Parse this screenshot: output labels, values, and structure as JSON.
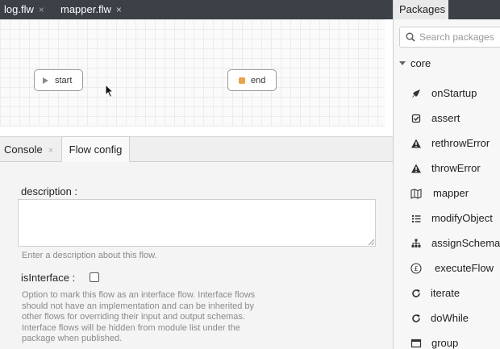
{
  "editor_tabs": [
    {
      "label": "log.flw",
      "close": "×"
    },
    {
      "label": "mapper.flw",
      "close": "×"
    }
  ],
  "flow_nodes": {
    "start": "start",
    "end": "end"
  },
  "bottom_tabs": {
    "console": {
      "label": "Console",
      "close": "×"
    },
    "flow_config": {
      "label": "Flow config"
    }
  },
  "config": {
    "description_label": "description :",
    "description_value": "",
    "description_help": "Enter a description about this flow.",
    "is_interface_label": "isInterface :",
    "is_interface_checked": false,
    "is_interface_help": "Option to mark this flow as an interface flow. Interface flows should not have an implementation and can be inherited by other flows for overriding their input and output schemas. Interface flows will be hidden from module list under the package when published."
  },
  "packages": {
    "title": "Packages",
    "search_placeholder": "Search packages",
    "group": "core",
    "items": [
      {
        "label": "onStartup",
        "icon": "rocket-icon"
      },
      {
        "label": "assert",
        "icon": "check-square-icon"
      },
      {
        "label": "rethrowError",
        "icon": "warning-icon"
      },
      {
        "label": "throwError",
        "icon": "warning-icon"
      },
      {
        "label": "mapper",
        "icon": "map-icon"
      },
      {
        "label": "modifyObject",
        "icon": "list-icon"
      },
      {
        "label": "assignSchema",
        "icon": "sitemap-icon"
      },
      {
        "label": "executeFlow",
        "icon": "pound-circle-icon"
      },
      {
        "label": "iterate",
        "icon": "redo-icon"
      },
      {
        "label": "doWhile",
        "icon": "redo-icon"
      },
      {
        "label": "group",
        "icon": "window-icon"
      }
    ]
  },
  "colors": {
    "tabbar": "#3c4047",
    "end_node_accent": "#e8a24a"
  }
}
